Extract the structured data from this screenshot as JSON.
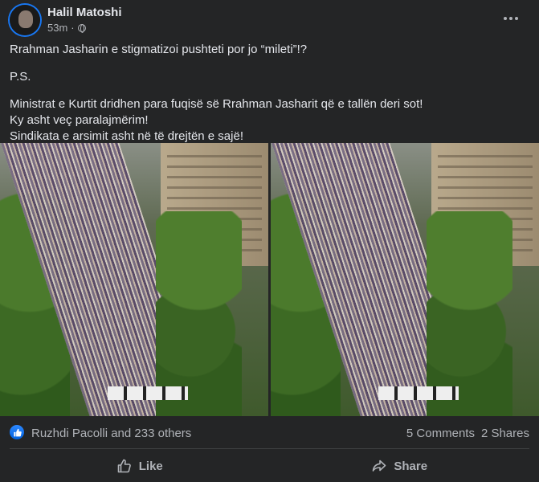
{
  "post": {
    "author": "Halil Matoshi",
    "timestamp": "53m",
    "separator": "·",
    "visibility_icon": "globe-icon",
    "lines": [
      "Rrahman Jasharin e stigmatizoi pushteti por jo “mileti”!?",
      "P.S.",
      "Ministrat e Kurtit dridhen para fuqisë së Rrahman Jasharit që e tallën deri sot!",
      "Ky asht veç paralajmërim!",
      "Sindikata e arsimit asht në të drejtën e sajë!"
    ]
  },
  "reactions": {
    "icon": "like-icon",
    "summary": "Ruzhdi Pacolli and 233 others",
    "comments": "5 Comments",
    "shares": "2 Shares"
  },
  "actions": {
    "like": "Like",
    "share": "Share"
  },
  "colors": {
    "background": "#242526",
    "text": "#e4e6eb",
    "secondary": "#b0b3b8",
    "accent": "#1877f2"
  }
}
